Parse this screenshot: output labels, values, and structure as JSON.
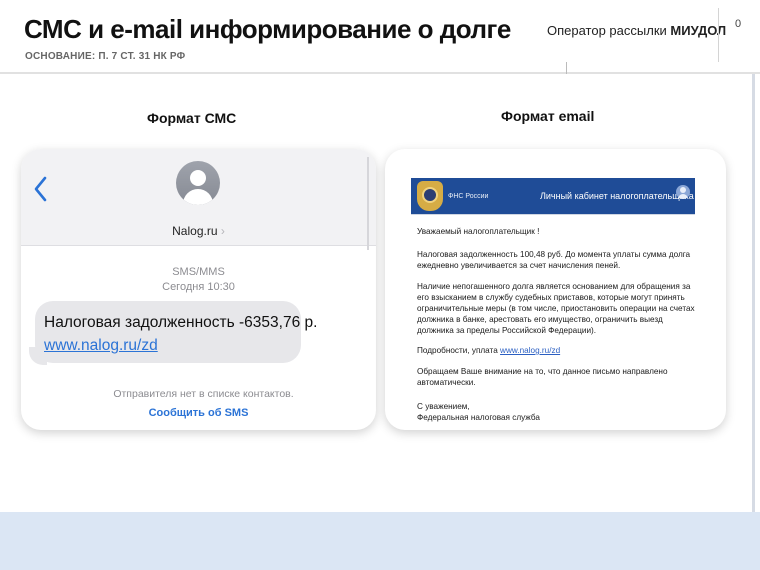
{
  "header": {
    "title": "СМС и e-mail информирование о долге",
    "subtitle": "ОСНОВАНИЕ: П. 7 СТ. 31 НК РФ",
    "operator_prefix": "Оператор рассылки ",
    "operator_name": "МИУДОЛ",
    "page_number": "0"
  },
  "columns": {
    "sms_label": "Формат СМС",
    "email_label": "Формат email"
  },
  "sms": {
    "sender": "Nalog.ru",
    "sender_chevron": "›",
    "type": "SMS/MMS",
    "time": "Сегодня 10:30",
    "message": "Налоговая задолженность -6353,76 р.",
    "link": "www.nalog.ru/zd",
    "not_in_contacts": "Отправителя нет в списке контактов.",
    "report_action": "Сообщить об SMS",
    "icons": {
      "back": "chevron-left-icon",
      "avatar": "contact-avatar-icon"
    }
  },
  "email": {
    "org_short": "ФНС России",
    "cabinet_title": "Личный кабинет налогоплательщика",
    "greeting": "Уважаемый налогоплательщик !",
    "p1_l1": "Налоговая задолженность 100,48 руб. До момента уплаты сумма долга",
    "p1_l2": "ежедневно увеличивается за счет начисления пеней.",
    "p2_l1": "Наличие непогашенного долга является основанием для обращения за",
    "p2_l2": "его взысканием в службу судебных приставов, которые могут принять",
    "p2_l3": "ограничительные меры (в том числе, приостановить операции на счетах",
    "p2_l4": "должника в банке, арестовать его имущество, ограничить выезд",
    "p2_l5": "должника за пределы Российской Федерации).",
    "p3_text": "Подробности, уплата ",
    "p3_link": "www.nalog.ru/zd",
    "p4_l1": "Обращаем Ваше внимание на то, что данное письмо направлено",
    "p4_l2": "автоматически.",
    "sign_l1": "С уважением,",
    "sign_l2": "Федеральная налоговая служба",
    "icons": {
      "emblem": "fns-emblem-icon",
      "user": "user-icon"
    }
  },
  "colors": {
    "link": "#2b73d6",
    "email_header": "#1f4c97",
    "bubble": "#e7e7ea",
    "footer_band": "#dbe6f4"
  }
}
